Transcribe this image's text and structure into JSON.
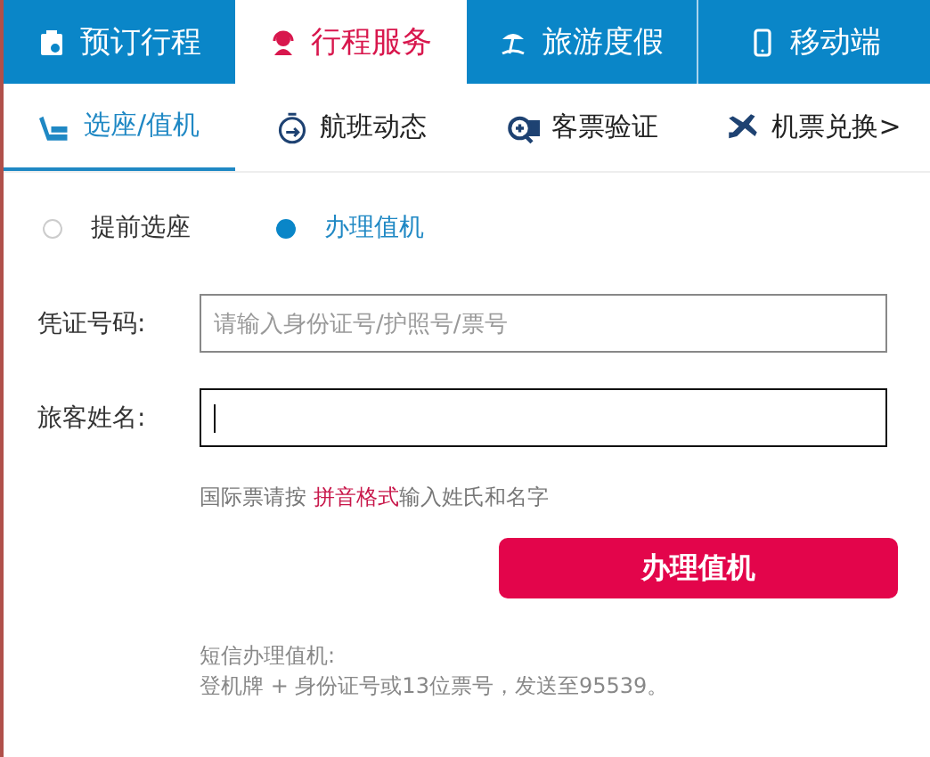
{
  "main_tabs": [
    {
      "label": "预订行程",
      "kind": "clipboard",
      "selected": false
    },
    {
      "label": "行程服务",
      "kind": "headset",
      "selected": true
    },
    {
      "label": "旅游度假",
      "kind": "umbrella",
      "selected": false
    },
    {
      "label": "移动端",
      "kind": "phone",
      "selected": false
    }
  ],
  "sub_tabs": [
    {
      "label": "选座/值机",
      "kind": "seat",
      "selected": true
    },
    {
      "label": "航班动态",
      "kind": "clock",
      "selected": false
    },
    {
      "label": "客票验证",
      "kind": "ticket",
      "selected": false
    },
    {
      "label": "机票兑换>",
      "kind": "plane",
      "selected": false
    }
  ],
  "modes": [
    {
      "label": "提前选座",
      "selected": false
    },
    {
      "label": "办理值机",
      "selected": true
    }
  ],
  "fields": [
    {
      "label": "凭证号码:",
      "placeholder": "请输入身份证号/护照号/票号",
      "focused": false
    },
    {
      "label": "旅客姓名:",
      "focused": true
    }
  ],
  "hint": {
    "before": "国际票请按 ",
    "link": "拼音格式",
    "after": "输入姓氏和名字"
  },
  "submit_button": "办理值机",
  "sms_note": {
    "title": "短信办理值机:",
    "text": "登机牌 + 身份证号或13位票号，发送至95539。"
  }
}
